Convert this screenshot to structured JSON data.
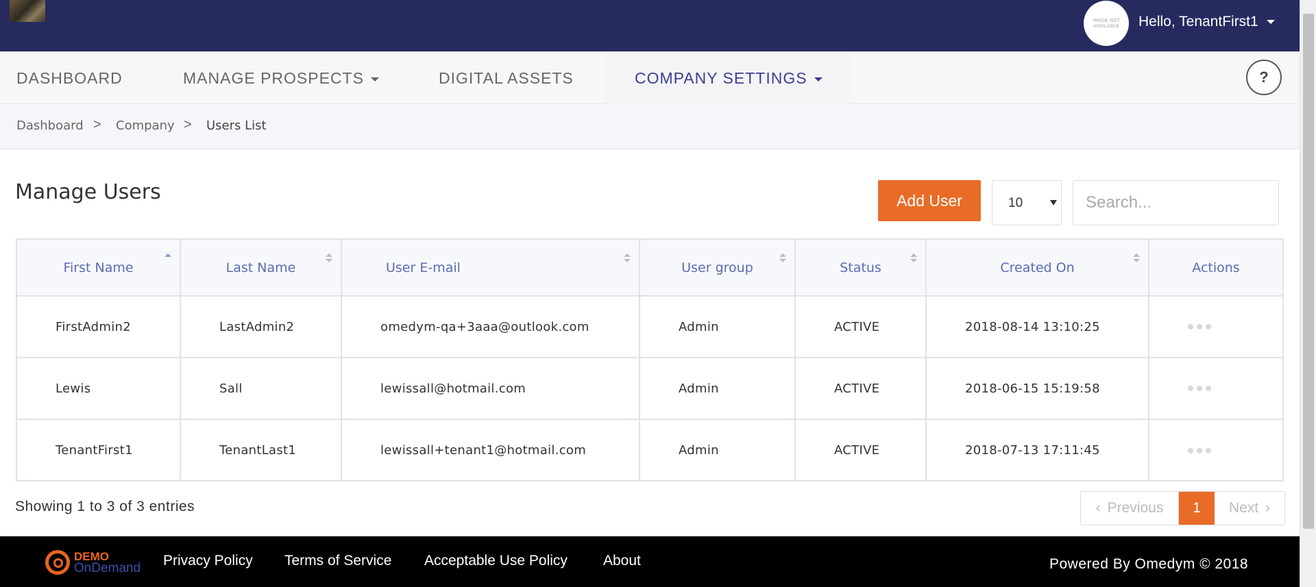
{
  "header": {
    "avatar_text": "IMAGE NOT AVAILABLE",
    "greeting": "Hello, TenantFirst1"
  },
  "nav": {
    "items": [
      {
        "label": "DASHBOARD"
      },
      {
        "label": "MANAGE PROSPECTS"
      },
      {
        "label": "DIGITAL ASSETS"
      },
      {
        "label": "COMPANY SETTINGS"
      }
    ],
    "help": "?"
  },
  "breadcrumb": {
    "items": [
      "Dashboard",
      "Company",
      "Users List"
    ],
    "separator": ">"
  },
  "main": {
    "title": "Manage Users",
    "add_user_label": "Add User",
    "page_size": "10",
    "search_placeholder": "Search..."
  },
  "table": {
    "columns": [
      "First Name",
      "Last Name",
      "User E-mail",
      "User group",
      "Status",
      "Created On",
      "Actions"
    ],
    "rows": [
      [
        "FirstAdmin2",
        "LastAdmin2",
        "omedym-qa+3aaa@outlook.com",
        "Admin",
        "ACTIVE",
        "2018-08-14 13:10:25"
      ],
      [
        "Lewis",
        "Sall",
        "lewissall@hotmail.com",
        "Admin",
        "ACTIVE",
        "2018-06-15 15:19:58"
      ],
      [
        "TenantFirst1",
        "TenantLast1",
        "lewissall+tenant1@hotmail.com",
        "Admin",
        "ACTIVE",
        "2018-07-13 17:11:45"
      ]
    ]
  },
  "pagination": {
    "info": "Showing 1 to 3 of 3 entries",
    "previous": "Previous",
    "current": "1",
    "next": "Next"
  },
  "footer": {
    "brand_line1": "DEMO",
    "brand_line2": "OnDemand",
    "links": [
      "Privacy Policy",
      "Terms of Service",
      "Acceptable Use Policy",
      "About"
    ],
    "powered": "Powered By Omedym © 2018"
  },
  "colors": {
    "header_bg": "#262a5e",
    "accent": "#e86c28",
    "nav_active": "#3c3f8f",
    "table_header_text": "#5c6bb0"
  }
}
